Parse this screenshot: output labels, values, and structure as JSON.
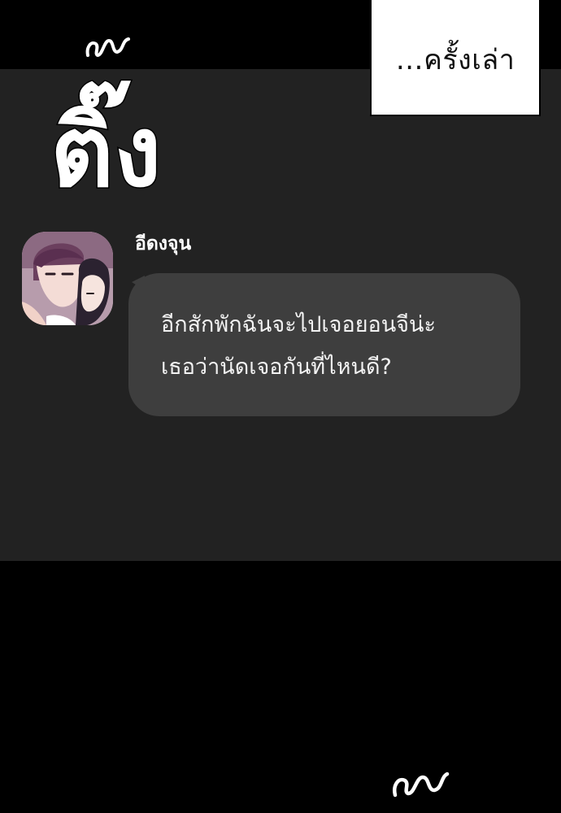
{
  "caption": {
    "text": "…ครั้งเล่า"
  },
  "sfx": {
    "large": "ติ๊ง"
  },
  "chat": {
    "sender_name": "อีดงจุน",
    "message_lines": [
      "อีกสักพักฉันจะไปเจอยอนจีน่ะ",
      "เธอว่านัดเจอกันที่ไหนดี?"
    ]
  },
  "colors": {
    "background": "#000000",
    "panel": "#222222",
    "bubble": "#3e3e3e",
    "bubble_text": "#f2f2f2",
    "caption_bg": "#ffffff"
  }
}
